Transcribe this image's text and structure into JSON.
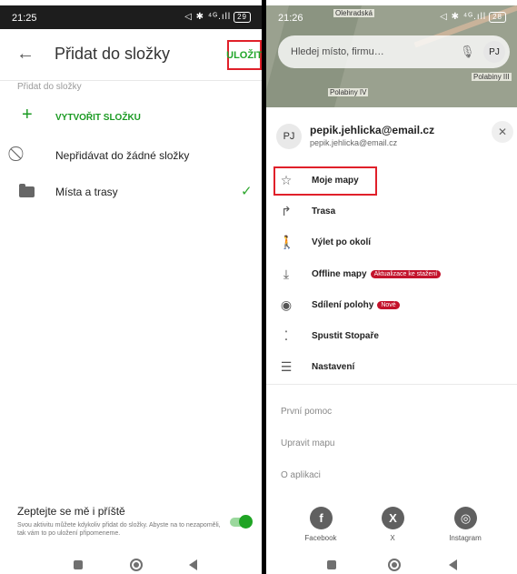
{
  "left": {
    "status": {
      "time": "21:25",
      "icons": "◁ ✱ ⁴ᴳ.ıll",
      "battery": "29"
    },
    "title": "Přidat do složky",
    "save_label": "ULOŽIT",
    "section_label": "Přidat do složky",
    "create_folder_label": "VYTVOŘIT SLOŽKU",
    "no_folder_label": "Nepřidávat do žádné složky",
    "folder_label": "Místa a trasy",
    "ask_title": "Zeptejte se mě i příště",
    "ask_desc": "Svou aktivitu můžete kdykoliv přidat do složky. Abyste na to nezapoměli, tak vám to po uložení připomeneme."
  },
  "right": {
    "status": {
      "time": "21:26",
      "icons": "◁ ✱ ⁴ᴳ.ıll",
      "battery": "28"
    },
    "map_labels": [
      "Polabiny IV",
      "Polabiny III",
      "Olehradská"
    ],
    "search_placeholder": "Hledej místo, firmu…",
    "user_initials": "PJ",
    "email": "pepik.jehlicka@email.cz",
    "email_sub": "pepik.jehlicka@email.cz",
    "menu": [
      {
        "label": "Moje mapy",
        "icon": "star-icon"
      },
      {
        "label": "Trasa",
        "icon": "route-icon"
      },
      {
        "label": "Výlet po okolí",
        "icon": "hiker-icon"
      },
      {
        "label": "Offline mapy",
        "icon": "download-icon",
        "badge": "Aktualizace ke stažení"
      },
      {
        "label": "Sdílení polohy",
        "icon": "share-location-icon",
        "badge": "Nové"
      },
      {
        "label": "Spustit Stopaře",
        "icon": "footprints-icon"
      },
      {
        "label": "Nastavení",
        "icon": "settings-sliders-icon"
      }
    ],
    "links": [
      "První pomoc",
      "Upravit mapu",
      "O aplikaci"
    ],
    "social": [
      {
        "label": "Facebook",
        "glyph": "f"
      },
      {
        "label": "X",
        "glyph": "X"
      },
      {
        "label": "Instagram",
        "glyph": "◎"
      }
    ]
  },
  "colors": {
    "accent_green": "#1a9a22",
    "highlight_red": "#e0202a",
    "badge_red": "#c3132b"
  }
}
